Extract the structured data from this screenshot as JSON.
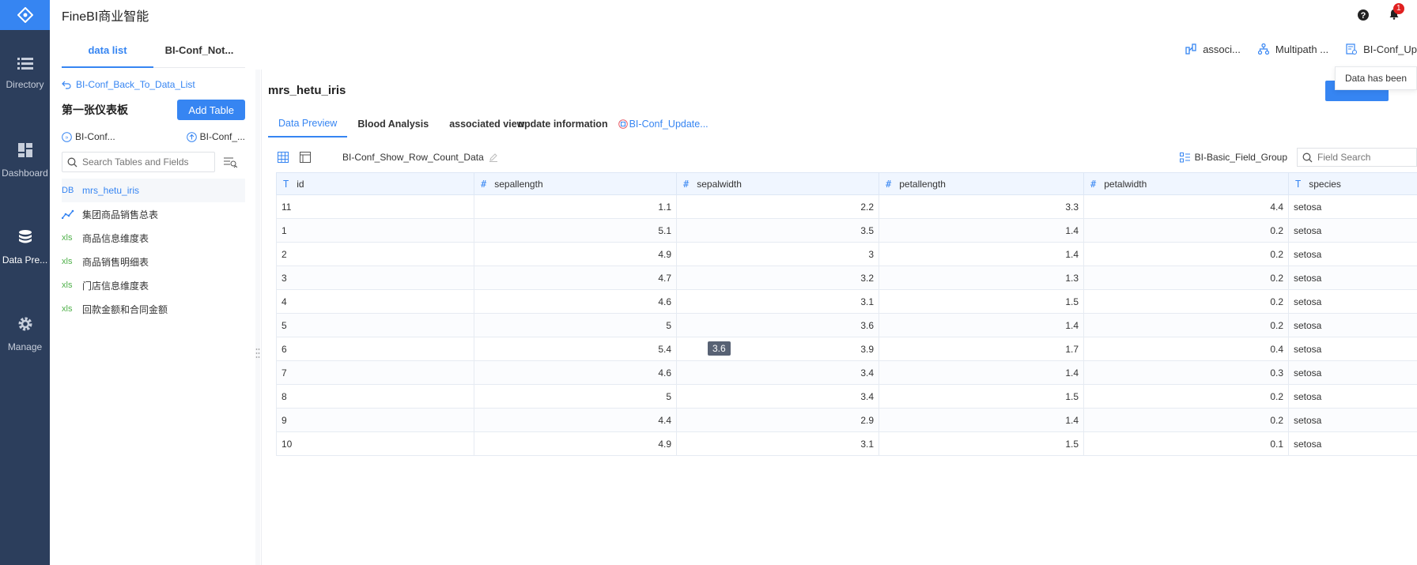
{
  "app": {
    "title": "FineBI商业智能",
    "notification_count": "1"
  },
  "nav": [
    {
      "label": "Directory",
      "icon": "list-icon"
    },
    {
      "label": "Dashboard",
      "icon": "dashboard-icon"
    },
    {
      "label": "Data Pre...",
      "icon": "database-icon"
    },
    {
      "label": "Manage",
      "icon": "gear-icon"
    }
  ],
  "left_tabs": [
    "data list",
    "BI-Conf_Not..."
  ],
  "right_tabs": [
    "associ...",
    "Multipath ...",
    "BI-Conf_Up"
  ],
  "panel": {
    "back_label": "BI-Conf_Back_To_Data_List",
    "title": "第一张仪表板",
    "add_table": "Add Table",
    "action1": "BI-Conf...",
    "action2": "BI-Conf_...",
    "search_placeholder": "Search Tables and Fields",
    "items": [
      {
        "tag": "DB",
        "label": "mrs_hetu_iris"
      },
      {
        "tag": "",
        "label": "集团商品销售总表"
      },
      {
        "tag": "xls",
        "label": "商品信息维度表"
      },
      {
        "tag": "xls",
        "label": "商品销售明细表"
      },
      {
        "tag": "xls",
        "label": "门店信息维度表"
      },
      {
        "tag": "xls",
        "label": "回款金额和合同金额"
      }
    ]
  },
  "main": {
    "title": "mrs_hetu_iris",
    "toast": "Data has been",
    "subtabs": [
      "Data Preview",
      "Blood Analysis",
      "associated view",
      "update information",
      "BI-Conf_Update..."
    ],
    "row_count_label": "BI-Conf_Show_Row_Count_Data",
    "field_group": "BI-Basic_Field_Group",
    "field_search_placeholder": "Field Search",
    "tooltip": "3.6",
    "columns": [
      {
        "name": "id",
        "type": "T"
      },
      {
        "name": "sepallength",
        "type": "#"
      },
      {
        "name": "sepalwidth",
        "type": "#"
      },
      {
        "name": "petallength",
        "type": "#"
      },
      {
        "name": "petalwidth",
        "type": "#"
      },
      {
        "name": "species",
        "type": "T"
      }
    ],
    "rows": [
      [
        "11",
        "1.1",
        "2.2",
        "3.3",
        "4.4",
        "setosa"
      ],
      [
        "1",
        "5.1",
        "3.5",
        "1.4",
        "0.2",
        "setosa"
      ],
      [
        "2",
        "4.9",
        "3",
        "1.4",
        "0.2",
        "setosa"
      ],
      [
        "3",
        "4.7",
        "3.2",
        "1.3",
        "0.2",
        "setosa"
      ],
      [
        "4",
        "4.6",
        "3.1",
        "1.5",
        "0.2",
        "setosa"
      ],
      [
        "5",
        "5",
        "3.6",
        "1.4",
        "0.2",
        "setosa"
      ],
      [
        "6",
        "5.4",
        "3.9",
        "1.7",
        "0.4",
        "setosa"
      ],
      [
        "7",
        "4.6",
        "3.4",
        "1.4",
        "0.3",
        "setosa"
      ],
      [
        "8",
        "5",
        "3.4",
        "1.5",
        "0.2",
        "setosa"
      ],
      [
        "9",
        "4.4",
        "2.9",
        "1.4",
        "0.2",
        "setosa"
      ],
      [
        "10",
        "4.9",
        "3.1",
        "1.5",
        "0.1",
        "setosa"
      ]
    ]
  },
  "colors": {
    "accent": "#3685f2",
    "nav_bg": "#2c3e5c"
  }
}
